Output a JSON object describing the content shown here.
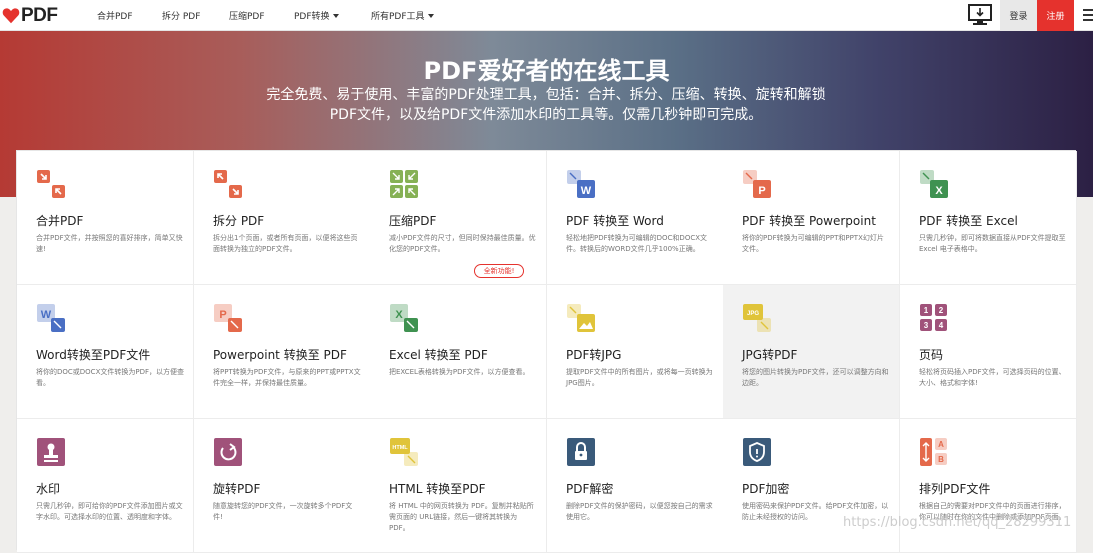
{
  "header": {
    "logo_text": "PDF",
    "nav": [
      {
        "label": "合并PDF"
      },
      {
        "label": "拆分 PDF"
      },
      {
        "label": "压缩PDF"
      },
      {
        "label": "PDF转换"
      },
      {
        "label": "所有PDF工具"
      }
    ],
    "login_label": "登录",
    "register_label": "注册"
  },
  "hero": {
    "title": "PDF爱好者的在线工具",
    "subtitle": "完全免费、易于使用、丰富的PDF处理工具，包括：合并、拆分、压缩、转换、旋转和解锁PDF文件，以及给PDF文件添加水印的工具等。仅需几秒钟即可完成。"
  },
  "tools": [
    {
      "title": "合并PDF",
      "desc": "合并PDF文件，并按照您的喜好排序，简单又快速!",
      "icon": "merge-icon",
      "color": "#e4694b"
    },
    {
      "title": "拆分 PDF",
      "desc": "拆分出1个页面，或者所有页面，以便将这些页面转换为独立的PDF文件。",
      "icon": "split-icon",
      "color": "#e4694b"
    },
    {
      "title": "压缩PDF",
      "desc": "减小PDF文件的尺寸，但同时保持最佳质量。优化您的PDF文件。",
      "icon": "compress-icon",
      "color": "#86b155"
    },
    {
      "title": "PDF 转换至 Word",
      "desc": "轻松地把PDF转换为可编辑的DOC和DOCX文件。转换后的WORD文件几乎100%正确。",
      "icon": "pdf-to-word-icon",
      "color": "#4a6fc4"
    },
    {
      "title": "PDF 转换至 Powerpoint",
      "desc": "将你的PDF转换为可编辑的PPT和PPTX幻灯片文件。",
      "icon": "pdf-to-ppt-icon",
      "color": "#e4694b"
    },
    {
      "title": "PDF 转换至 Excel",
      "desc": "只需几秒钟，即可将数据直接从PDF文件提取至Excel 电子表格中。",
      "icon": "pdf-to-excel-icon",
      "color": "#3f9251"
    },
    {
      "title": "Word转换至PDF文件",
      "desc": "将你的DOC或DOCX文件转换为PDF，以方便查看。",
      "icon": "word-to-pdf-icon",
      "color": "#4a6fc4"
    },
    {
      "title": "Powerpoint 转换至 PDF",
      "desc": "将PPT转换为PDF文件，与原来的PPT或PPTX文件完全一样，并保持最佳质量。",
      "icon": "ppt-to-pdf-icon",
      "color": "#e4694b"
    },
    {
      "title": "Excel 转换至 PDF",
      "desc": "把EXCEL表格转换为PDF文件，以方便查看。",
      "icon": "excel-to-pdf-icon",
      "color": "#3f9251"
    },
    {
      "title": "PDF转JPG",
      "desc": "提取PDF文件中的所有图片，或将每一页转换为JPG图片。",
      "icon": "pdf-to-jpg-icon",
      "color": "#e0c43a"
    },
    {
      "title": "JPG转PDF",
      "desc": "将您的图片转换为PDF文件，还可以调整方向和边距。",
      "icon": "jpg-to-pdf-icon",
      "color": "#e0c43a"
    },
    {
      "title": "页码",
      "desc": "轻松将页码插入PDF文件，可选择页码的位置、大小、格式和字体!",
      "icon": "page-numbers-icon",
      "color": "#a0527a"
    },
    {
      "title": "水印",
      "desc": "只需几秒钟，即可给你的PDF文件添加图片或文字水印。可选择水印的位置、透明度和字体。",
      "icon": "watermark-icon",
      "color": "#a0527a"
    },
    {
      "title": "旋转PDF",
      "desc": "随意旋转您的PDF文件，一次旋转多个PDF文件!",
      "icon": "rotate-icon",
      "color": "#a0527a"
    },
    {
      "title": "HTML 转换至PDF",
      "desc": "将 HTML 中的网页转换为 PDF。复制并粘贴所需页面的 URL链接，然后一键将其转换为 PDF。",
      "icon": "html-to-pdf-icon",
      "color": "#e0c43a"
    },
    {
      "title": "PDF解密",
      "desc": "删除PDF文件的保护密码，以便您按自己的需求使用它。",
      "icon": "unlock-icon",
      "color": "#3a5a7a"
    },
    {
      "title": "PDF加密",
      "desc": "使用密码来保护PDF文件。给PDF文件加密，以防止未经授权的访问。",
      "icon": "protect-icon",
      "color": "#3a5a7a"
    },
    {
      "title": "排列PDF文件",
      "desc": "根据自己的需要对PDF文件中的页面进行排序，你可以随时在你的文件中删除或添加PDF页面。",
      "icon": "organize-icon",
      "color": "#e4694b"
    }
  ],
  "new_badge": "全新功能!",
  "watermark": "https://blog.csdn.net/qq_28299311"
}
